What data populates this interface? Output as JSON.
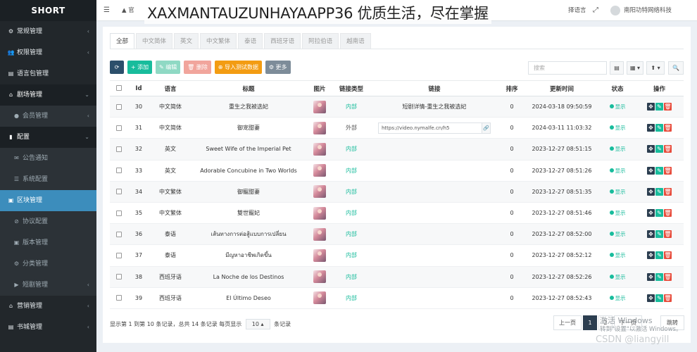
{
  "sidebar": {
    "brand": "SHORT",
    "items": [
      {
        "icon": "⚙",
        "label": "常规管理",
        "type": "parent",
        "caret": "‹"
      },
      {
        "icon": "👥",
        "label": "权限管理",
        "type": "parent",
        "caret": "‹"
      },
      {
        "icon": "▤",
        "label": "语言包管理",
        "type": "parent",
        "caret": ""
      },
      {
        "icon": "⌂",
        "label": "剧场管理",
        "type": "open",
        "caret": "⌄"
      },
      {
        "icon": "●",
        "label": "会员管理",
        "type": "sub",
        "caret": "‹"
      },
      {
        "icon": "▮",
        "label": "配置",
        "type": "open",
        "caret": "⌄"
      },
      {
        "icon": "✉",
        "label": "公告通知",
        "type": "sub",
        "caret": ""
      },
      {
        "icon": "☰",
        "label": "系统配置",
        "type": "sub",
        "caret": ""
      },
      {
        "icon": "▣",
        "label": "区块管理",
        "type": "active",
        "caret": ""
      },
      {
        "icon": "⊘",
        "label": "协议配置",
        "type": "sub",
        "caret": ""
      },
      {
        "icon": "▣",
        "label": "版本管理",
        "type": "sub",
        "caret": ""
      },
      {
        "icon": "⚙",
        "label": "分类管理",
        "type": "sub",
        "caret": ""
      },
      {
        "icon": "▶",
        "label": "短剧管理",
        "type": "sub",
        "caret": "‹"
      },
      {
        "icon": "⌂",
        "label": "营销管理",
        "type": "parent",
        "caret": "‹"
      },
      {
        "icon": "▤",
        "label": "书城管理",
        "type": "parent",
        "caret": "‹"
      }
    ]
  },
  "topbar": {
    "menu_icon": "☰",
    "home_text": "官",
    "watermark": "XAXMANTAUZUNHAYAAPP36 优质生活，尽在掌握",
    "lang_label": "择语言",
    "fullscreen_icon": "⤢",
    "user_name": "南阳功特网络科技"
  },
  "lang_tabs": [
    "全部",
    "中文简体",
    "英文",
    "中文繁体",
    "泰语",
    "西班牙语",
    "阿拉伯语",
    "越南语"
  ],
  "toolbar": {
    "refresh": "⟳",
    "add": "+ 添加",
    "edit": "✎ 编辑",
    "delete": "🗑 删除",
    "import": "⊕ 导入测试数据",
    "more": "⚙ 更多"
  },
  "search": {
    "placeholder": "搜索"
  },
  "tools": {
    "list": "▤",
    "grid": "▦ ▾",
    "export": "⬆ ▾",
    "search": "🔍"
  },
  "table": {
    "headers": [
      "",
      "Id",
      "语言",
      "标题",
      "图片",
      "链接类型",
      "链接",
      "排序",
      "更新时间",
      "状态",
      "操作"
    ],
    "rows": [
      {
        "id": "30",
        "lang": "中文简体",
        "title": "重生之我被选妃",
        "link_type": "内部",
        "link": "短剧详情-重生之我被选妃",
        "link_kind": "text",
        "sort": "0",
        "time": "2024-03-18 09:50:59",
        "status": "显示"
      },
      {
        "id": "31",
        "lang": "中文简体",
        "title": "御宠甜妻",
        "link_type": "外部",
        "link": "https://video.nymalfe.cn/h5",
        "link_kind": "url",
        "sort": "0",
        "time": "2024-03-11 11:03:32",
        "status": "显示"
      },
      {
        "id": "32",
        "lang": "英文",
        "title": "Sweet Wife of the Imperial Pet",
        "link_type": "内部",
        "link": "",
        "link_kind": "text",
        "sort": "0",
        "time": "2023-12-27 08:51:15",
        "status": "显示"
      },
      {
        "id": "33",
        "lang": "英文",
        "title": "Adorable Concubine in Two Worlds",
        "link_type": "内部",
        "link": "",
        "link_kind": "text",
        "sort": "0",
        "time": "2023-12-27 08:51:26",
        "status": "显示"
      },
      {
        "id": "34",
        "lang": "中文繁体",
        "title": "御寵甜妻",
        "link_type": "内部",
        "link": "",
        "link_kind": "text",
        "sort": "0",
        "time": "2023-12-27 08:51:35",
        "status": "显示"
      },
      {
        "id": "35",
        "lang": "中文繁体",
        "title": "雙世寵妃",
        "link_type": "内部",
        "link": "",
        "link_kind": "text",
        "sort": "0",
        "time": "2023-12-27 08:51:46",
        "status": "显示"
      },
      {
        "id": "36",
        "lang": "泰语",
        "title": "เส้นทางการต่อสู้แบบการเปลี่ยน",
        "link_type": "内部",
        "link": "",
        "link_kind": "text",
        "sort": "0",
        "time": "2023-12-27 08:52:00",
        "status": "显示"
      },
      {
        "id": "37",
        "lang": "泰语",
        "title": "มีญหาอาชีพเกิดขึ้น",
        "link_type": "内部",
        "link": "",
        "link_kind": "text",
        "sort": "0",
        "time": "2023-12-27 08:52:12",
        "status": "显示"
      },
      {
        "id": "38",
        "lang": "西班牙语",
        "title": "La Noche de los Destinos",
        "link_type": "内部",
        "link": "",
        "link_kind": "text",
        "sort": "0",
        "time": "2023-12-27 08:52:26",
        "status": "显示"
      },
      {
        "id": "39",
        "lang": "西班牙语",
        "title": "El Último Deseo",
        "link_type": "内部",
        "link": "",
        "link_kind": "text",
        "sort": "0",
        "time": "2023-12-27 08:52:43",
        "status": "显示"
      }
    ],
    "op_icons": {
      "drag": "✥",
      "edit": "✎",
      "del": "🗑"
    }
  },
  "footer": {
    "info_before": "显示第 1 到第 10 条记录，总共 14 条记录 每页显示",
    "page_size": "10 ▴",
    "info_after": "条记录"
  },
  "pager": {
    "prev": "上一页",
    "p1": "1",
    "p2": "2",
    "next": "下一页",
    "jump": "跳转"
  },
  "overlays": {
    "win_title": "激活 Windows",
    "win_sub": "转到\"设置\"以激活 Windows。",
    "csdn": "CSDN @liangyill"
  },
  "colors": {
    "sidebar": "#22272b",
    "active": "#3c8dbc",
    "success": "#18bc9c",
    "danger": "#e74c3c",
    "dark": "#2c3e50",
    "warning": "#f39c12"
  }
}
